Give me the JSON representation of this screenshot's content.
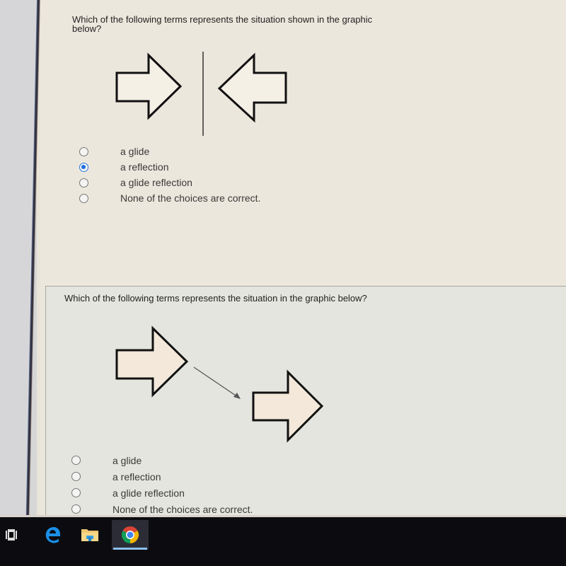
{
  "questions": [
    {
      "text": "Which of the following terms represents the situation shown in the graphic below?",
      "graphic": "two-arrows-facing-a-vertical-line",
      "options": [
        {
          "label": "a glide",
          "selected": false
        },
        {
          "label": "a reflection",
          "selected": true
        },
        {
          "label": "a glide reflection",
          "selected": false
        },
        {
          "label": "None of the choices are correct.",
          "selected": false
        }
      ]
    },
    {
      "text": "Which of the following terms represents the situation in the graphic below?",
      "graphic": "arrow-translated-diagonally",
      "options": [
        {
          "label": "a glide",
          "selected": false
        },
        {
          "label": "a reflection",
          "selected": false
        },
        {
          "label": "a glide reflection",
          "selected": false
        },
        {
          "label": "None of the choices are correct.",
          "selected": false
        }
      ]
    }
  ],
  "taskbar": {
    "items": [
      {
        "name": "Task View",
        "icon": "task-view-icon"
      },
      {
        "name": "Microsoft Edge",
        "icon": "edge-icon"
      },
      {
        "name": "File Explorer",
        "icon": "folder-icon"
      },
      {
        "name": "Google Chrome",
        "icon": "chrome-icon",
        "active": true
      }
    ]
  },
  "colors": {
    "radio_selected": "#1a6fe0",
    "arrow_fill_q2": "#f3e8da",
    "taskbar": "#0c0c10",
    "active_indicator": "#8cc0ee"
  }
}
